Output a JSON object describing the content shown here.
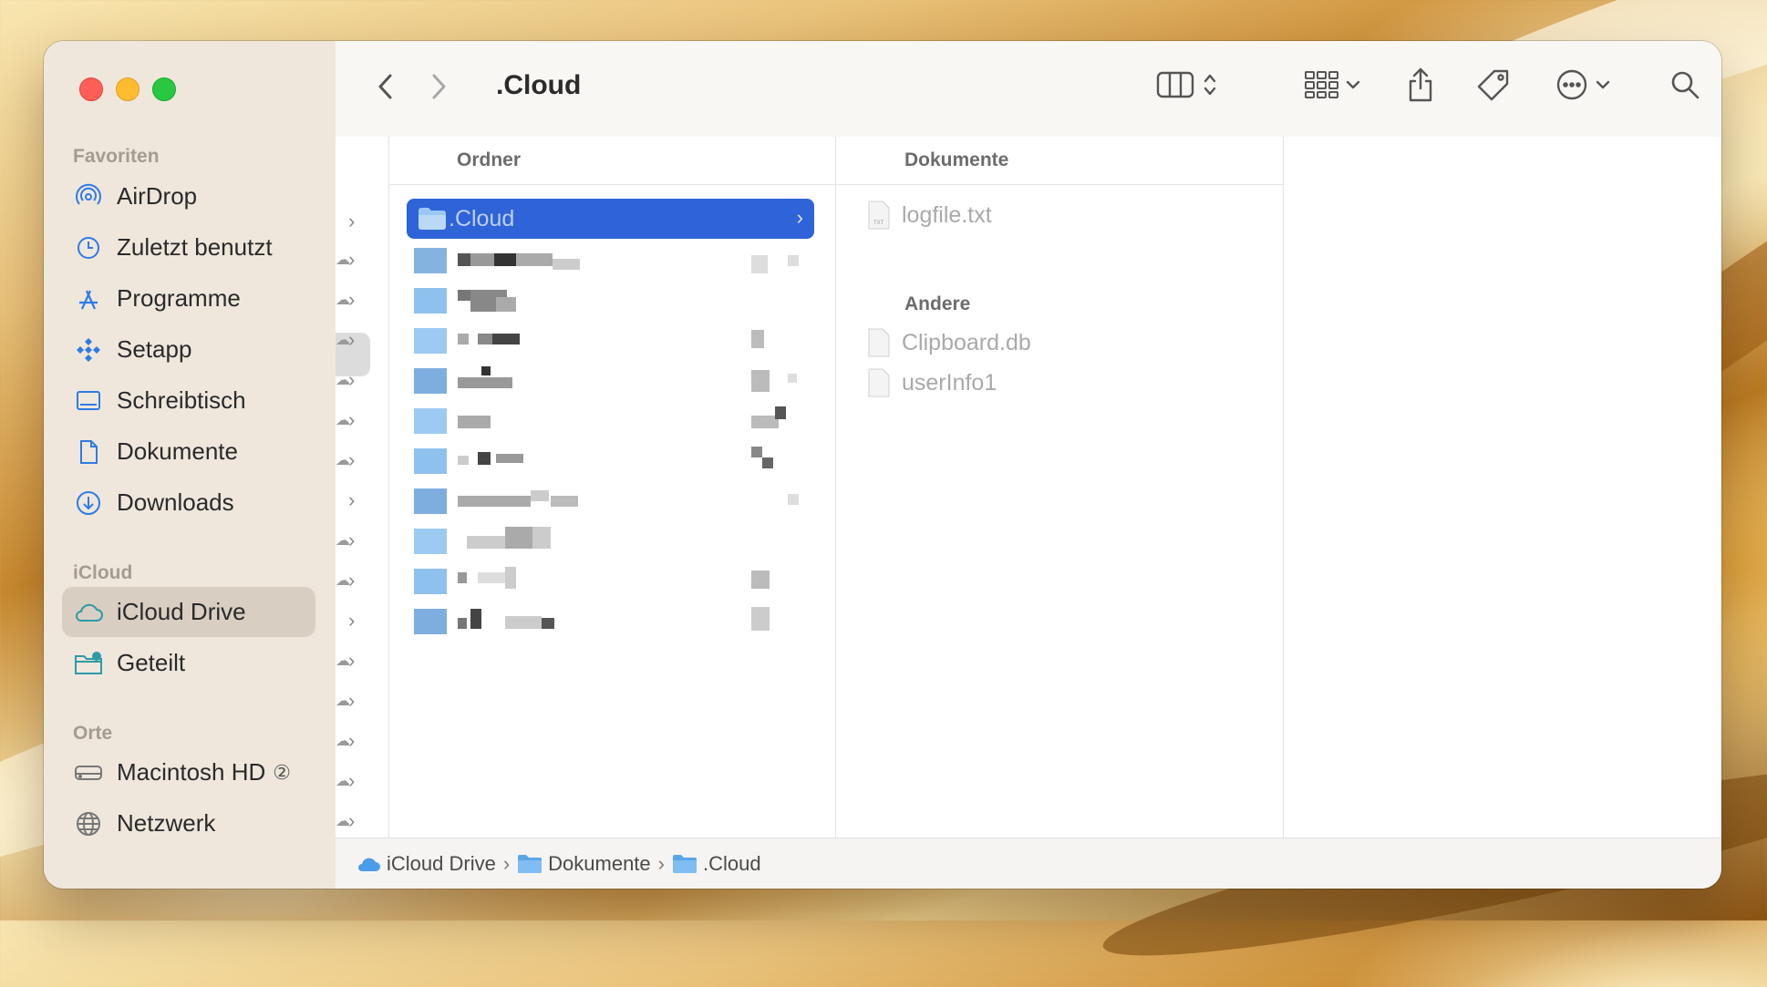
{
  "window": {
    "title": ".Cloud"
  },
  "sidebar": {
    "sections": [
      {
        "title": "Favoriten",
        "items": [
          {
            "label": "AirDrop",
            "icon": "airdrop-icon"
          },
          {
            "label": "Zuletzt benutzt",
            "icon": "clock-icon"
          },
          {
            "label": "Programme",
            "icon": "apps-icon"
          },
          {
            "label": "Setapp",
            "icon": "setapp-icon"
          },
          {
            "label": "Schreibtisch",
            "icon": "desktop-icon"
          },
          {
            "label": "Dokumente",
            "icon": "document-icon"
          },
          {
            "label": "Downloads",
            "icon": "download-icon"
          }
        ]
      },
      {
        "title": "iCloud",
        "items": [
          {
            "label": "iCloud Drive",
            "icon": "cloud-icon",
            "selected": true
          },
          {
            "label": "Geteilt",
            "icon": "shared-folder-icon"
          }
        ]
      },
      {
        "title": "Orte",
        "items": [
          {
            "label": "Macintosh HD",
            "icon": "harddisk-icon",
            "badge": "②"
          },
          {
            "label": "Netzwerk",
            "icon": "globe-icon"
          }
        ]
      }
    ]
  },
  "columns": {
    "folders": {
      "header": "Ordner",
      "selected": ".Cloud",
      "blurred_rows": 10
    },
    "documents": {
      "header": "Dokumente",
      "items": [
        "logfile.txt"
      ],
      "other_header": "Andere",
      "other_items": [
        "Clipboard.db",
        "userInfo1"
      ]
    }
  },
  "pathbar": {
    "items": [
      "iCloud Drive",
      "Dokumente",
      ".Cloud"
    ],
    "separator": "›"
  },
  "colors": {
    "accent": "#2f63d8",
    "sidebar_bg": "#efe7dc",
    "sidebar_selected": "#d9cec2"
  }
}
